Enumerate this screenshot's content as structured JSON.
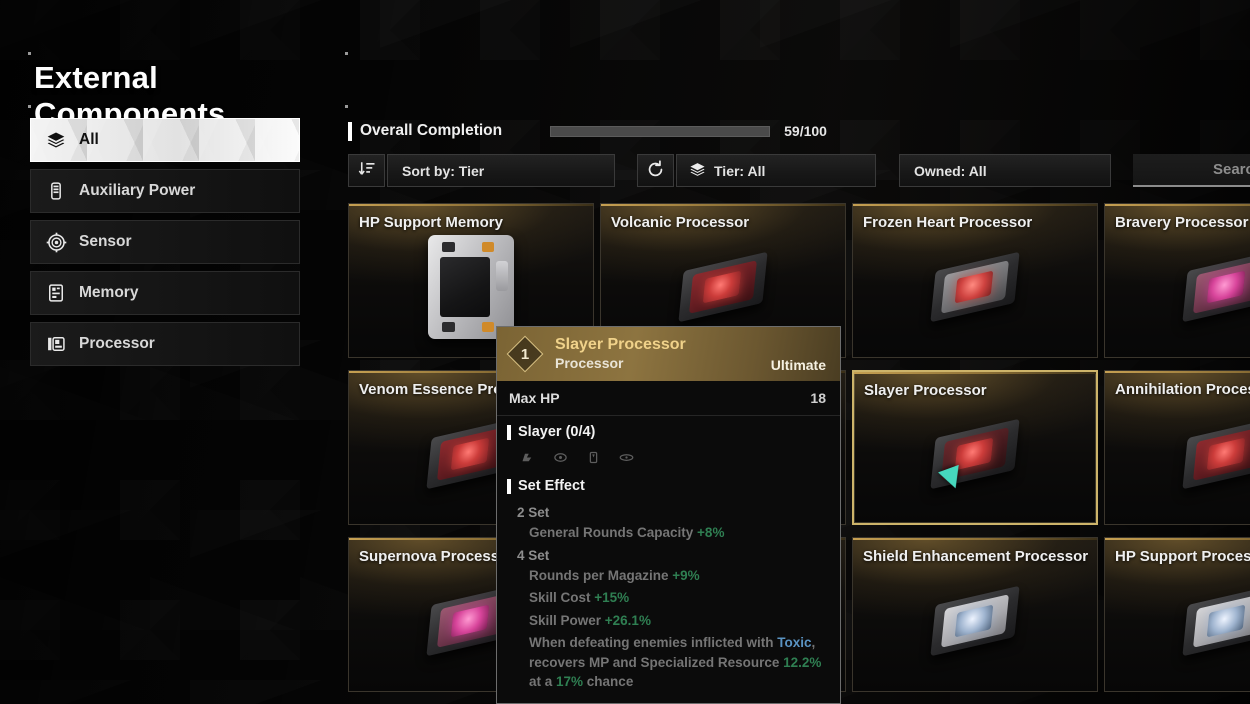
{
  "page_title": "External Components",
  "sidebar": {
    "items": [
      {
        "label": "All",
        "icon": "layers-icon",
        "active": true
      },
      {
        "label": "Auxiliary Power",
        "icon": "battery-module-icon",
        "active": false
      },
      {
        "label": "Sensor",
        "icon": "sensor-icon",
        "active": false
      },
      {
        "label": "Memory",
        "icon": "memory-chip-icon",
        "active": false
      },
      {
        "label": "Processor",
        "icon": "processor-icon",
        "active": false
      }
    ]
  },
  "completion": {
    "label": "Overall Completion",
    "value_text": "59/100",
    "percent": 59
  },
  "toolbar": {
    "sort_label": "Sort by: Tier",
    "sort_icon": "sort-descending-icon",
    "reset_icon": "reset-icon",
    "tier_label": "Tier: All",
    "tier_icon": "layers-icon",
    "owned_label": "Owned: All",
    "search_placeholder": "Search"
  },
  "grid": {
    "cards": [
      {
        "title": "HP Support Memory",
        "art": "memory-module",
        "selected": false
      },
      {
        "title": "Volcanic Processor",
        "art": "chip-red",
        "selected": false
      },
      {
        "title": "Frozen Heart Processor",
        "art": "chip-grey",
        "selected": false
      },
      {
        "title": "Bravery Processor",
        "art": "chip-pink",
        "selected": false
      },
      {
        "title": "Venom Essence Processor",
        "art": "chip-red",
        "selected": false
      },
      {
        "title": "",
        "art": "chip-red",
        "selected": false
      },
      {
        "title": "Slayer Processor",
        "art": "chip-dark",
        "selected": true
      },
      {
        "title": "Annihilation Processor",
        "art": "chip-red",
        "selected": false
      },
      {
        "title": "Supernova Processor",
        "art": "chip-pink",
        "selected": false
      },
      {
        "title": "",
        "art": "chip-red",
        "selected": false
      },
      {
        "title": "Shield Enhancement Processor",
        "art": "chip-white",
        "selected": false
      },
      {
        "title": "HP Support Processor",
        "art": "chip-white",
        "selected": false
      }
    ]
  },
  "tooltip": {
    "tier_badge": "1",
    "name": "Slayer Processor",
    "type": "Processor",
    "rarity": "Ultimate",
    "stat_label": "Max HP",
    "stat_value": "18",
    "set_name": "Slayer (0/4)",
    "set_effect_label": "Set Effect",
    "slot_icons": [
      "helmet-slot-icon",
      "chest-slot-icon",
      "arm-slot-icon",
      "leg-slot-icon"
    ],
    "set_2_label": "2 Set",
    "set_2_effects": [
      {
        "text": "General Rounds Capacity ",
        "value": "+8%"
      }
    ],
    "set_4_label": "4 Set",
    "set_4_effects": [
      {
        "text": "Rounds per Magazine ",
        "value": "+9%"
      },
      {
        "text": "Skill Cost ",
        "value": "+15%"
      },
      {
        "text": "Skill Power ",
        "value": "+26.1%"
      }
    ],
    "set_4_description_pre": "When defeating enemies inflicted with ",
    "set_4_description_keyword": "Toxic",
    "set_4_description_mid": ", recovers MP and Specialized Resource ",
    "set_4_description_value1": "12.2%",
    "set_4_description_mid2": " at a ",
    "set_4_description_value2": "17%",
    "set_4_description_end": " chance"
  },
  "colors": {
    "accent_gold": "#cdb46a",
    "positive_green": "#2f7f52",
    "keyword_blue": "#5a93c2",
    "cursor_teal": "#46d7bd"
  }
}
